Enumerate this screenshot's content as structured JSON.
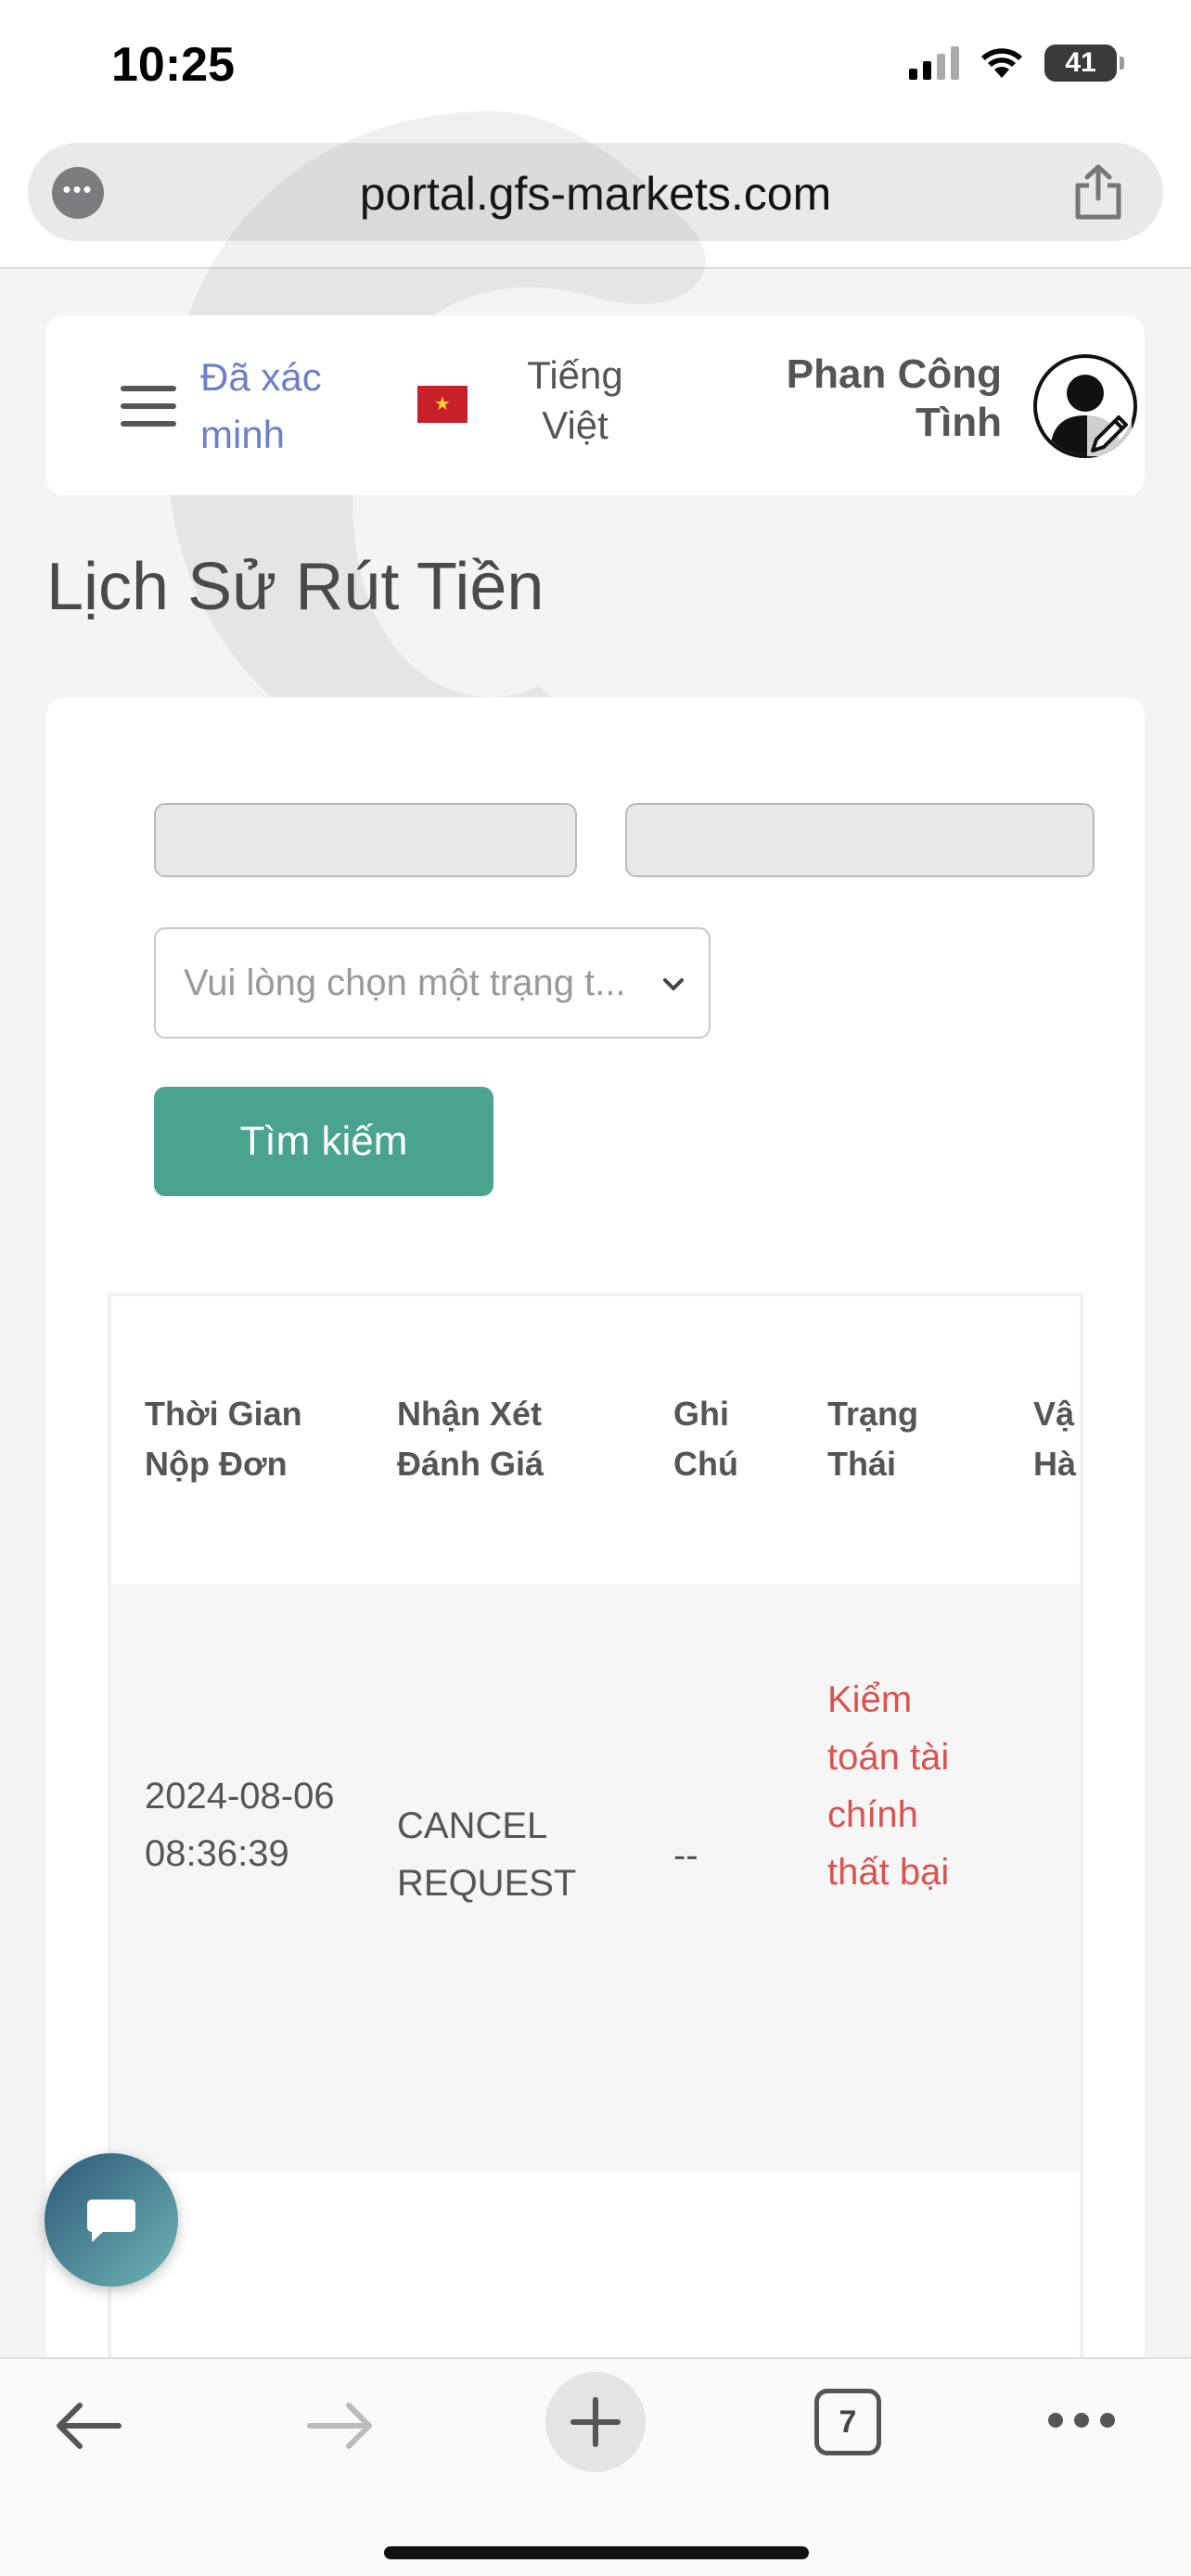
{
  "status_bar": {
    "time": "10:25",
    "battery": "41"
  },
  "browser": {
    "url": "portal.gfs-markets.com",
    "tab_count": "7"
  },
  "header": {
    "verified_label": "Đã xác minh",
    "language_label": "Tiếng Việt",
    "flag_star": "★",
    "user_name": "Phan Công Tình"
  },
  "page": {
    "title": "Lịch Sử Rút Tiền"
  },
  "filters": {
    "status_placeholder": "Vui lòng chọn một trạng t...",
    "search_label": "Tìm kiếm"
  },
  "table": {
    "columns": [
      "Thời Gian Nộp Đơn",
      "Nhận Xét Đánh Giá",
      "Ghi Chú",
      "Trạng Thái",
      "Vậ Hà"
    ],
    "rows": [
      {
        "time": "2024-08-06 08:36:39",
        "review": "CANCEL REQUEST",
        "note": "--",
        "status": "Kiểm toán tài chính thất bại"
      }
    ]
  },
  "colors": {
    "accent": "#4aa391",
    "verified": "#6c7fc9",
    "status_failed": "#d9534f"
  },
  "icons": [
    "ellipsis-icon",
    "share-icon",
    "hamburger-icon",
    "vietnam-flag-icon",
    "avatar-icon",
    "pencil-icon",
    "chevron-down-icon",
    "chat-icon",
    "back-arrow-icon",
    "forward-arrow-icon",
    "plus-icon",
    "tabs-icon",
    "more-icon"
  ]
}
